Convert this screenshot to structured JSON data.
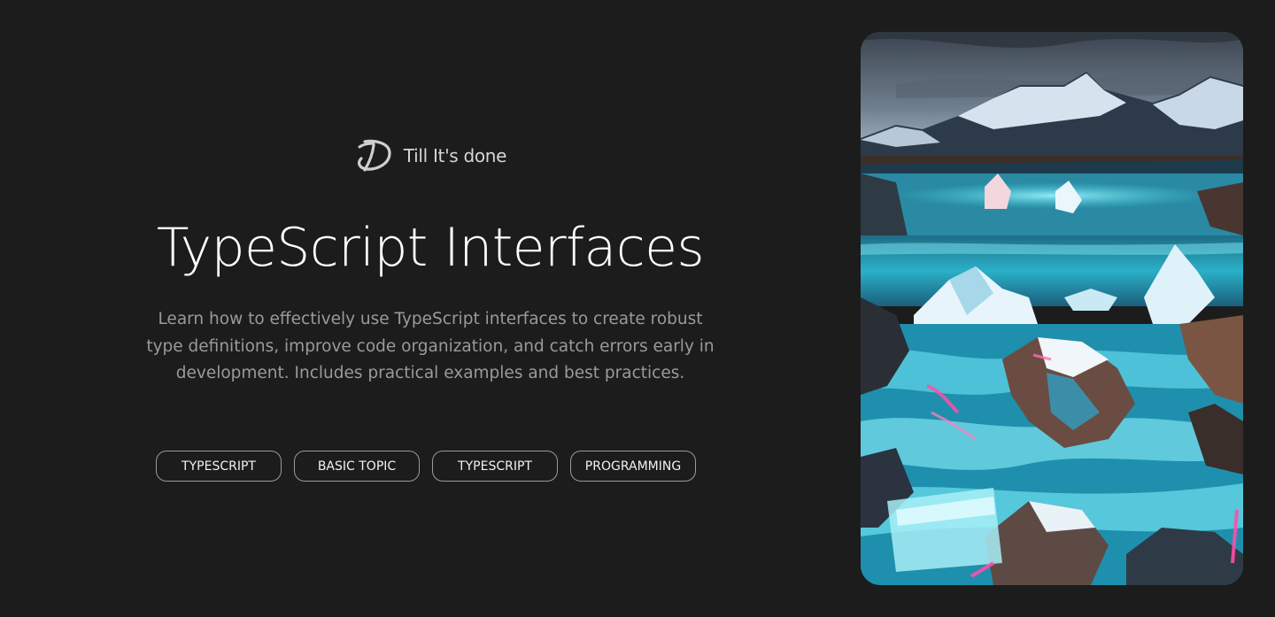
{
  "brand": {
    "name": "Till It's done",
    "logo_icon": "td-monogram-icon"
  },
  "hero": {
    "title": "TypeScript Interfaces",
    "description": "Learn how to effectively use TypeScript interfaces to create robust type definitions, improve code organization, and catch errors early in development. Includes practical examples and best practices."
  },
  "tags": [
    {
      "label": "TYPESCRIPT"
    },
    {
      "label": "BASIC TOPIC"
    },
    {
      "label": "TYPESCRIPT"
    },
    {
      "label": "PROGRAMMING"
    }
  ],
  "image": {
    "alt": "Glacial landscape with turquoise waterfalls and snowy mountains"
  },
  "colors": {
    "background": "#1c1c1c",
    "title": "#ffffff",
    "description": "#9a9a9a",
    "tag_border": "#9a9a9a",
    "accent_turquoise": "#3fd0e0",
    "accent_pink": "#ff4fa8"
  }
}
